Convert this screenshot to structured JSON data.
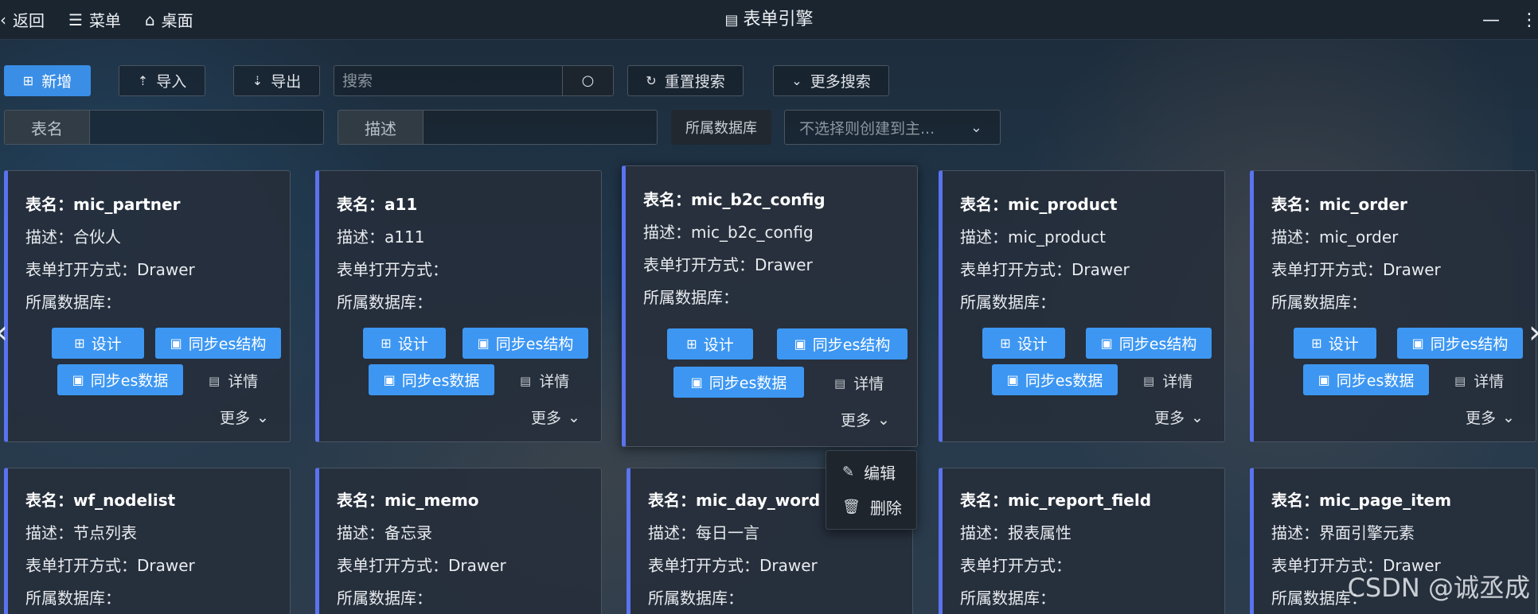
{
  "titlebar": {
    "back": "返回",
    "menu": "菜单",
    "desktop": "桌面",
    "title": "表单引擎",
    "icons": {
      "back": "chevron-left-icon",
      "menu": "menu-icon",
      "desktop": "home-icon",
      "title": "form-icon",
      "minimize": "minimize-icon",
      "maximize": "maximize-icon"
    }
  },
  "toolbar": {
    "add_label": "新增",
    "import_label": "导入",
    "export_label": "导出",
    "search_placeholder": "搜索",
    "reset_label": "重置搜索",
    "more_search_label": "更多搜索"
  },
  "filters": {
    "name_label": "表名",
    "desc_label": "描述",
    "db_label": "所属数据库",
    "db_placeholder": "不选择则创建到主..."
  },
  "card_labels": {
    "design": "设计",
    "sync_structure": "同步es结构",
    "sync_data": "同步es数据",
    "detail": "详情",
    "more": "更多"
  },
  "cards_row1": [
    {
      "name": "表名：mic_partner",
      "desc": "描述：合伙人",
      "open": "表单打开方式：Drawer",
      "db": "所属数据库："
    },
    {
      "name": "表名：a11",
      "desc": "描述：a111",
      "open": "表单打开方式：",
      "db": "所属数据库："
    },
    {
      "name": "表名：mic_b2c_config",
      "desc": "描述：mic_b2c_config",
      "open": "表单打开方式：Drawer",
      "db": "所属数据库："
    },
    {
      "name": "表名：mic_product",
      "desc": "描述：mic_product",
      "open": "表单打开方式：Drawer",
      "db": "所属数据库："
    },
    {
      "name": "表名：mic_order",
      "desc": "描述：mic_order",
      "open": "表单打开方式：Drawer",
      "db": "所属数据库："
    }
  ],
  "cards_row2": [
    {
      "name": "表名：wf_nodelist",
      "desc": "描述：节点列表",
      "open": "表单打开方式：Drawer",
      "db": "所属数据库："
    },
    {
      "name": "表名：mic_memo",
      "desc": "描述：备忘录",
      "open": "表单打开方式：Drawer",
      "db": "所属数据库："
    },
    {
      "name": "表名：mic_day_word",
      "desc": "描述：每日一言",
      "open": "表单打开方式：Drawer",
      "db": "所属数据库："
    },
    {
      "name": "表名：mic_report_field",
      "desc": "描述：报表属性",
      "open": "表单打开方式：",
      "db": "所属数据库："
    },
    {
      "name": "表名：mic_page_item",
      "desc": "描述：界面引擎元素",
      "open": "表单打开方式：Drawer",
      "db": "所属数据库："
    }
  ],
  "dropdown": {
    "edit": "编辑",
    "delete": "删除"
  },
  "watermark": "CSDN @诚丞成",
  "colors": {
    "primary": "#3a8ee6",
    "card_accent": "#5a73f0",
    "card_button": "#3d97f2"
  }
}
